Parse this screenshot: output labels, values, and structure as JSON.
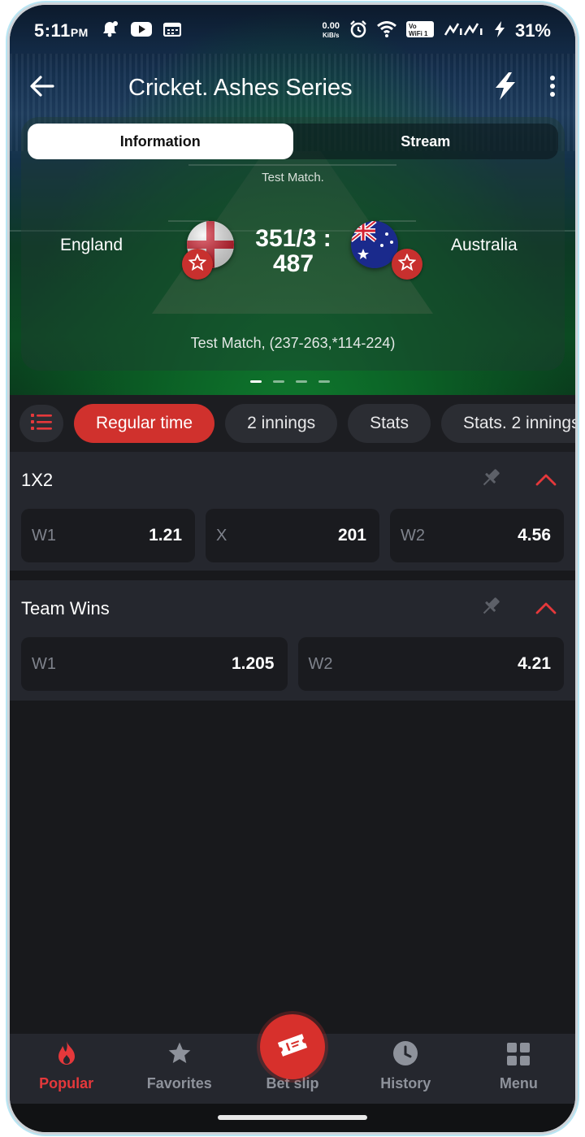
{
  "status_bar": {
    "time": "5:11",
    "ampm": "PM",
    "net_speed_value": "0.00",
    "net_speed_unit": "KiB/s",
    "battery": "31%",
    "icons": [
      "notification-bell-icon",
      "youtube-icon",
      "calendar-icon",
      "alarm-icon",
      "wifi-icon",
      "vowifi-icon",
      "signal-icon",
      "signal-icon",
      "charging-icon"
    ]
  },
  "app_bar": {
    "title": "Cricket. Ashes Series"
  },
  "match": {
    "tabs": [
      {
        "label": "Information",
        "active": true
      },
      {
        "label": "Stream",
        "active": false
      }
    ],
    "type": "Test Match.",
    "team_home": "England",
    "team_away": "Australia",
    "score_line1": "351/3 :",
    "score_line2": "487",
    "summary": "Test Match, (237-263,*114-224)",
    "pager_pages": 4,
    "pager_active": 1
  },
  "filters": {
    "chips": [
      {
        "label": "Regular time",
        "active": true
      },
      {
        "label": "2 innings",
        "active": false
      },
      {
        "label": "Stats",
        "active": false
      },
      {
        "label": "Stats. 2 innings",
        "active": false
      }
    ]
  },
  "markets": [
    {
      "title": "1X2",
      "odds": [
        {
          "label": "W1",
          "value": "1.21"
        },
        {
          "label": "X",
          "value": "201"
        },
        {
          "label": "W2",
          "value": "4.56"
        }
      ]
    },
    {
      "title": "Team Wins",
      "odds": [
        {
          "label": "W1",
          "value": "1.205"
        },
        {
          "label": "W2",
          "value": "4.21"
        }
      ]
    }
  ],
  "bottom_nav": {
    "items": [
      {
        "label": "Popular",
        "icon": "flame-icon",
        "active": true
      },
      {
        "label": "Favorites",
        "icon": "star-icon",
        "active": false
      },
      {
        "label": "Bet slip",
        "icon": "ticket-icon",
        "active": false
      },
      {
        "label": "History",
        "icon": "clock-icon",
        "active": false
      },
      {
        "label": "Menu",
        "icon": "grid-icon",
        "active": false
      }
    ]
  },
  "colors": {
    "accent": "#d0312d",
    "background": "#18191c",
    "card": "#25272e",
    "odd_cell": "#1a1b1f"
  }
}
